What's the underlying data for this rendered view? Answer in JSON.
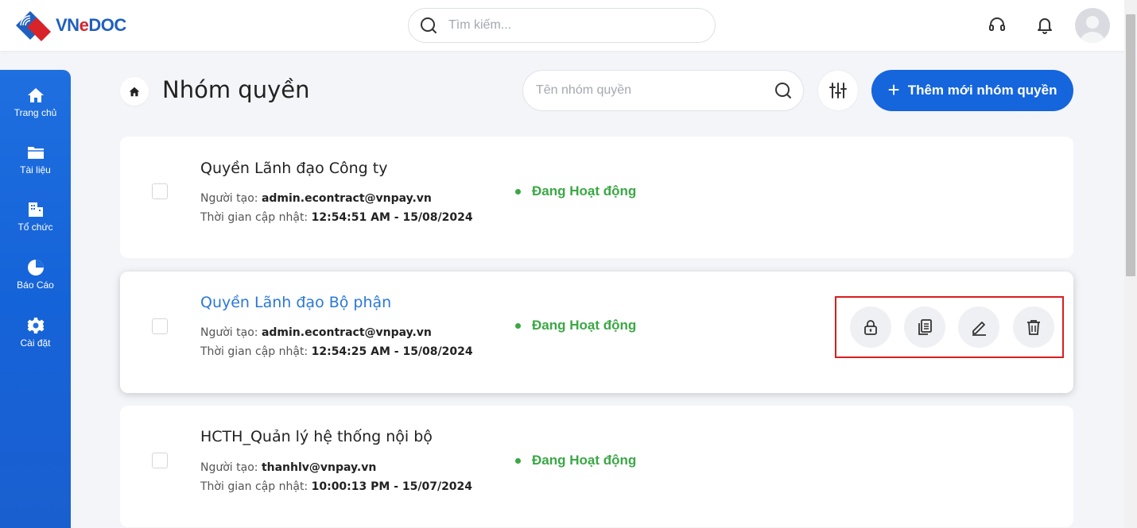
{
  "header": {
    "logo_text_pre": "VN",
    "logo_text_e": "e",
    "logo_text_post": "DOC",
    "search_placeholder": "Tìm kiếm...",
    "icons": [
      "headset-icon",
      "bell-icon",
      "avatar"
    ]
  },
  "sidebar": {
    "items": [
      {
        "label": "Trang chủ",
        "icon": "home-icon"
      },
      {
        "label": "Tài liệu",
        "icon": "folder-icon"
      },
      {
        "label": "Tổ chức",
        "icon": "building-icon"
      },
      {
        "label": "Báo Cáo",
        "icon": "pie-chart-icon"
      },
      {
        "label": "Cài đặt",
        "icon": "gear-icon"
      }
    ]
  },
  "page": {
    "title": "Nhóm quyền",
    "search_placeholder": "Tên nhóm quyền",
    "add_button_label": "Thêm mới nhóm quyền"
  },
  "labels": {
    "creator": "Người tạo:",
    "updated": "Thời gian cập nhật:"
  },
  "groups": [
    {
      "name": "Quyền Lãnh đạo Công ty",
      "creator": "admin.econtract@vnpay.vn",
      "updated": "12:54:51 AM - 15/08/2024",
      "status": "Đang Hoạt động"
    },
    {
      "name": "Quyền Lãnh đạo Bộ phận",
      "creator": "admin.econtract@vnpay.vn",
      "updated": "12:54:25 AM - 15/08/2024",
      "status": "Đang Hoạt động"
    },
    {
      "name": "HCTH_Quản lý hệ thống nội bộ",
      "creator": "thanhlv@vnpay.vn",
      "updated": "10:00:13 PM - 15/07/2024",
      "status": "Đang Hoạt động"
    }
  ],
  "colors": {
    "primary": "#1565dd",
    "status_active": "#3aa845",
    "highlight_box": "#d81e1e",
    "active_name": "#2a78d6"
  }
}
